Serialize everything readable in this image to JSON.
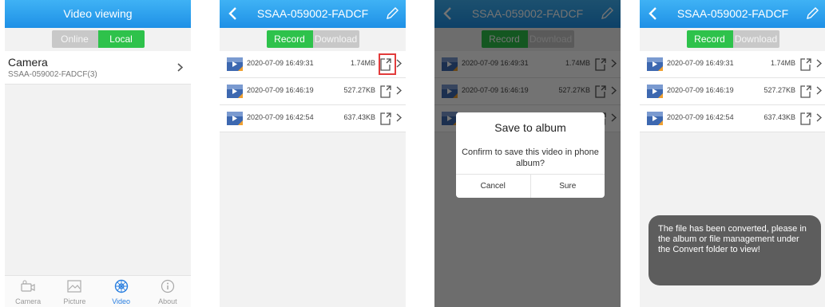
{
  "screen1": {
    "title": "Video viewing",
    "segment": {
      "online": "Online",
      "local": "Local"
    },
    "camera": {
      "name": "Camera",
      "id": "SSAA-059002-FADCF(3)"
    },
    "tabs": [
      {
        "label": "Camera",
        "icon": "camera-icon"
      },
      {
        "label": "Picture",
        "icon": "picture-icon"
      },
      {
        "label": "Video",
        "icon": "video-icon",
        "active": true
      },
      {
        "label": "About",
        "icon": "info-icon"
      }
    ]
  },
  "device_title": "SSAA-059002-FADCF",
  "segment2": {
    "record": "Record",
    "download": "Download"
  },
  "videos": [
    {
      "date": "2020-07-09 16:49:31",
      "size": "1.74MB"
    },
    {
      "date": "2020-07-09 16:46:19",
      "size": "527.27KB"
    },
    {
      "date": "2020-07-09 16:42:54",
      "size": "637.43KB"
    }
  ],
  "dialog": {
    "title": "Save to album",
    "message": "Confirm to save this video in phone album?",
    "cancel": "Cancel",
    "confirm": "Sure"
  },
  "toast": "The file has been converted, please in the album or file management under the Convert folder to view!",
  "colors": {
    "header": "#1e90e6",
    "accent_green": "#2ec24b",
    "highlight": "#e23b3b",
    "active_tab": "#2a7fe0"
  }
}
